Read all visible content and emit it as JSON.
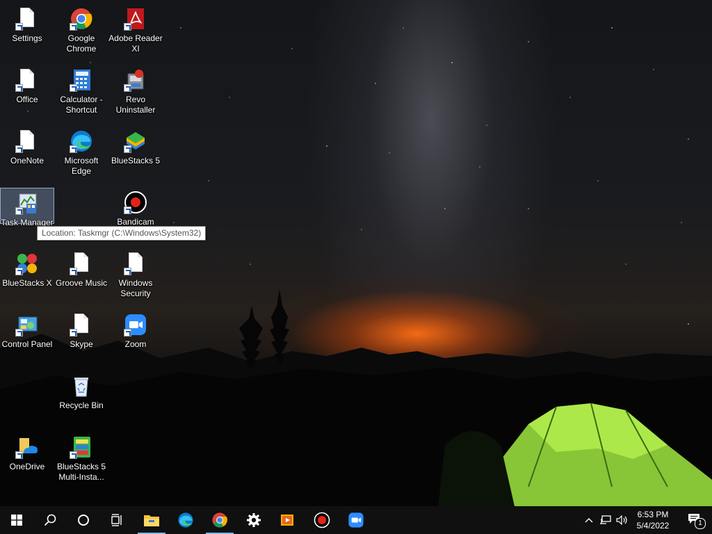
{
  "desktop": {
    "icons": [
      {
        "label": "Settings",
        "icon": "settings-shortcut-icon"
      },
      {
        "label": "Google Chrome",
        "icon": "chrome-icon"
      },
      {
        "label": "Adobe Reader XI",
        "icon": "adobe-reader-icon"
      },
      {
        "label": "Office",
        "icon": "office-shortcut-icon"
      },
      {
        "label": "Calculator - Shortcut",
        "icon": "calculator-icon"
      },
      {
        "label": "Revo Uninstaller",
        "icon": "revo-uninstaller-icon"
      },
      {
        "label": "OneNote",
        "icon": "onenote-shortcut-icon"
      },
      {
        "label": "Microsoft Edge",
        "icon": "edge-icon"
      },
      {
        "label": "BlueStacks 5",
        "icon": "bluestacks-icon"
      },
      {
        "label": "Task Manager",
        "icon": "task-manager-icon"
      },
      {
        "label": "Bandicam",
        "icon": "bandicam-icon"
      },
      {
        "label": "BlueStacks X",
        "icon": "bluestacks-x-icon"
      },
      {
        "label": "Groove Music",
        "icon": "groove-music-shortcut-icon"
      },
      {
        "label": "Windows Security",
        "icon": "windows-security-shortcut-icon"
      },
      {
        "label": "Control Panel",
        "icon": "control-panel-icon"
      },
      {
        "label": "Skype",
        "icon": "skype-shortcut-icon"
      },
      {
        "label": "Zoom",
        "icon": "zoom-icon"
      },
      {
        "label": "Recycle Bin",
        "icon": "recycle-bin-icon"
      },
      {
        "label": "OneDrive",
        "icon": "onedrive-icon"
      },
      {
        "label": "BlueStacks 5 Multi-Insta...",
        "icon": "bluestacks-multi-instance-icon"
      }
    ],
    "tooltip": "Location: Taskmgr (C:\\Windows\\System32)"
  },
  "taskbar": {
    "buttons": [
      "start-icon",
      "search-icon",
      "cortana-icon",
      "task-view-icon",
      "file-explorer-icon",
      "edge-icon",
      "chrome-icon",
      "settings-gear-icon",
      "media-player-icon",
      "bandicam-record-icon",
      "zoom-icon"
    ],
    "tray": [
      "chevron-up-icon",
      "network-icon",
      "volume-icon"
    ],
    "clock": {
      "time": "6:53 PM",
      "date": "5/4/2022"
    },
    "notification_count": "1",
    "accent": "#76b9ed"
  }
}
